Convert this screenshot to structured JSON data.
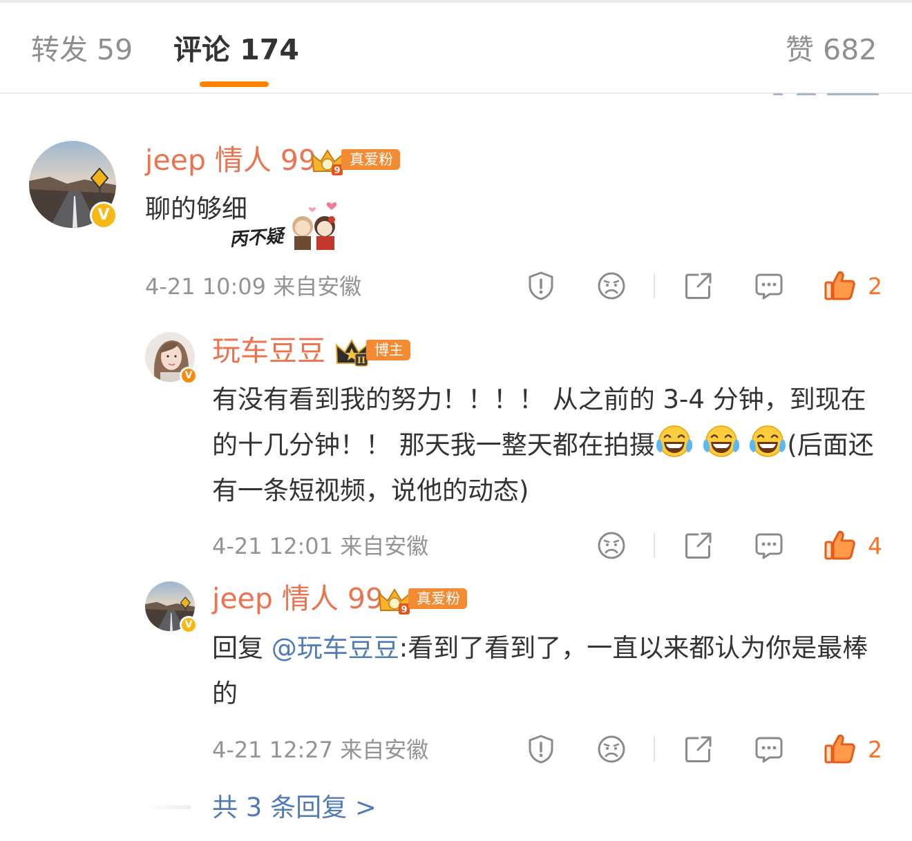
{
  "tabs": {
    "repost": "转发 59",
    "comments": "评论 174",
    "likes": "赞 682"
  },
  "comments": [
    {
      "user": "jeep 情人 99",
      "badge": "真爱粉",
      "text": "聊的够细",
      "sticker_text": "丙不疑",
      "time": "4-21 10:09",
      "location": "来自安徽",
      "likes": "2"
    },
    {
      "user": "玩车豆豆",
      "badge": "博主",
      "text_a": "有没有看到我的努力！！！！ 从之前的 3-4 分钟，到现在的十几分钟！！ 那天我一整天都在拍摄",
      "text_b": "(后面还有一条短视频，说他的动态)",
      "time": "4-21 12:01",
      "location": "来自安徽",
      "likes": "4"
    },
    {
      "user": "jeep 情人 99",
      "badge": "真爱粉",
      "reply_prefix": "回复 ",
      "mention": "@玩车豆豆",
      "text": ":看到了看到了，一直以来都认为你是最棒的",
      "time": "4-21 12:27",
      "location": "来自安徽",
      "likes": "2"
    }
  ],
  "more_replies": "共 3 条回复 >",
  "colors": {
    "accent": "#ff8200",
    "username": "#eb7350",
    "link": "#4f7bb7",
    "meta": "#939393",
    "like": "#ff6f1f"
  },
  "icons": [
    "report-icon",
    "dislike-face-icon",
    "share-icon",
    "comment-icon",
    "thumbs-up-icon",
    "verified-v-icon",
    "crown-icon",
    "laughing-tears-emoji"
  ]
}
